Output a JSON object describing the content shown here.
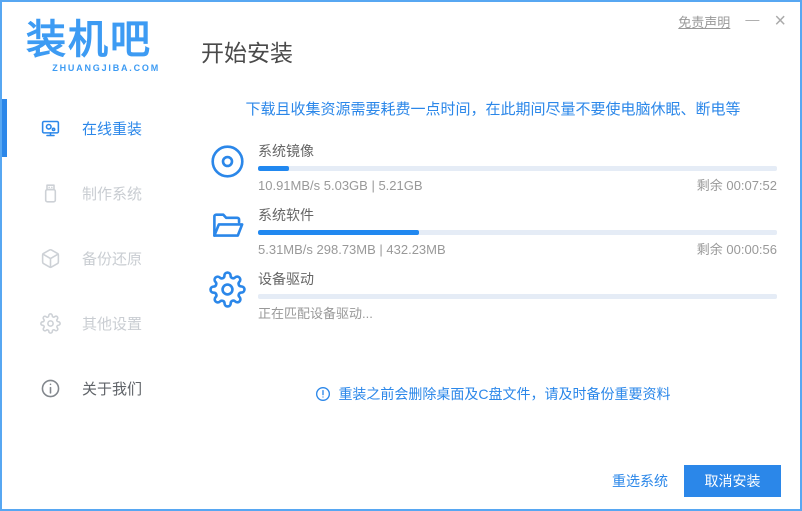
{
  "colors": {
    "accent": "#2B87E9",
    "logo": "#3D9BF3",
    "progress": "#2188F0",
    "track": "#E5ECF6",
    "border": "#57A7F2"
  },
  "header": {
    "logo_text": "装机吧",
    "logo_domain": "ZHUANGJIBA.COM",
    "title": "开始安装",
    "disclaimer_label": "免责声明",
    "minimize_glyph": "—",
    "close_glyph": "×"
  },
  "sidebar": {
    "items": [
      {
        "label": "在线重装",
        "icon": "monitor-icon",
        "active": true
      },
      {
        "label": "制作系统",
        "icon": "usb-icon",
        "active": false
      },
      {
        "label": "备份还原",
        "icon": "backup-box-icon",
        "active": false
      },
      {
        "label": "其他设置",
        "icon": "gear-icon",
        "active": false
      },
      {
        "label": "关于我们",
        "icon": "info-icon",
        "active": false
      }
    ]
  },
  "main": {
    "notice_top": "下载且收集资源需要耗费一点时间，在此期间尽量不要使电脑休眠、断电等",
    "tasks": [
      {
        "name": "系统镜像",
        "progress_percent": 6,
        "stats_left": "10.91MB/s 5.03GB | 5.21GB",
        "stats_right": "剩余 00:07:52"
      },
      {
        "name": "系统软件",
        "progress_percent": 31,
        "stats_left": "5.31MB/s 298.73MB | 432.23MB",
        "stats_right": "剩余 00:00:56"
      },
      {
        "name": "设备驱动",
        "progress_percent": 0,
        "stats_left": "正在匹配设备驱动...",
        "stats_right": ""
      }
    ],
    "notice_bottom": "重装之前会删除桌面及C盘文件，请及时备份重要资料"
  },
  "footer": {
    "reselect_label": "重选系统",
    "cancel_label": "取消安装"
  }
}
